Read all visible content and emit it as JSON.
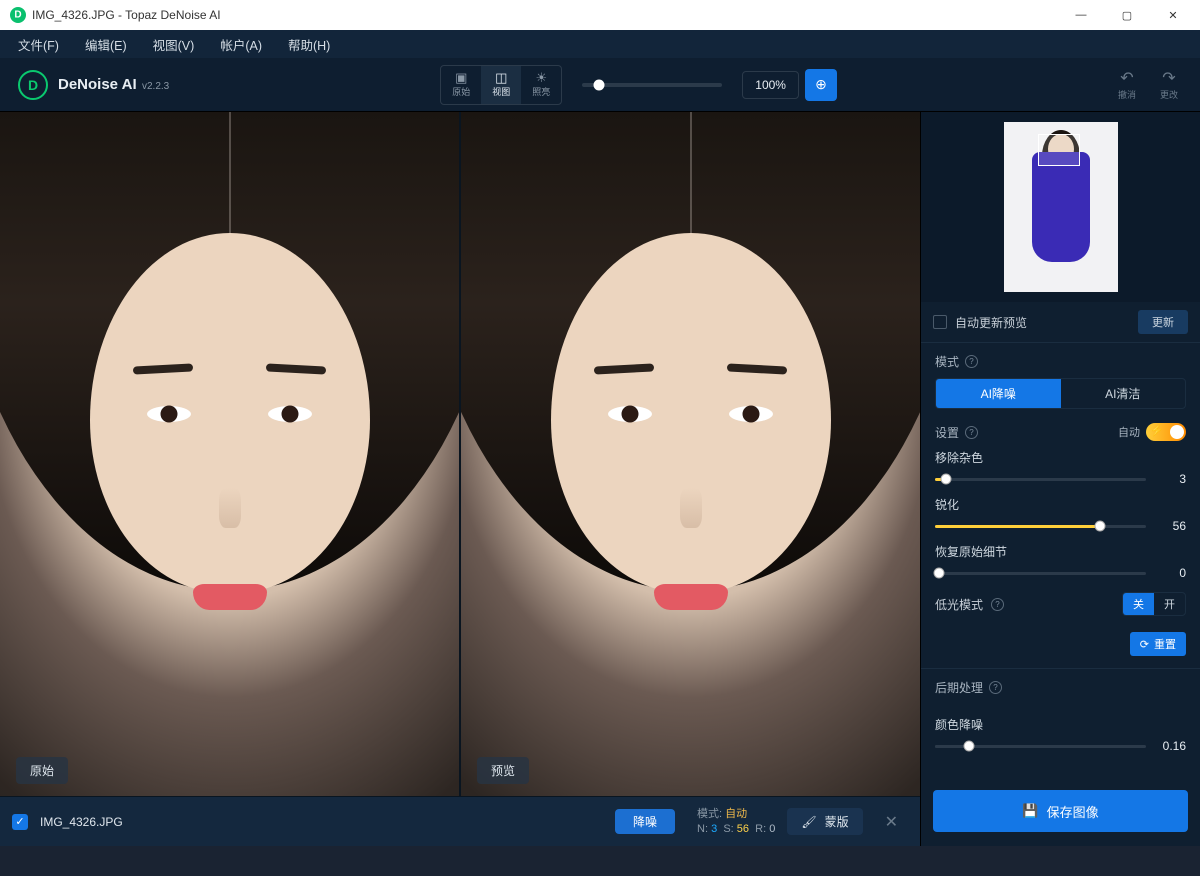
{
  "titlebar": {
    "title": "IMG_4326.JPG - Topaz DeNoise AI"
  },
  "menubar": {
    "file": "文件(F)",
    "edit": "编辑(E)",
    "view": "视图(V)",
    "account": "帐户(A)",
    "help": "帮助(H)"
  },
  "brand": {
    "name": "DeNoise AI",
    "version": "v2.2.3"
  },
  "toolbar": {
    "viewModes": {
      "single": "原始",
      "split": "视图",
      "light": "照亮"
    },
    "zoom": "100%",
    "undo": "撤消",
    "redo": "更改"
  },
  "viewer": {
    "originalLabel": "原始",
    "previewLabel": "预览"
  },
  "bottom": {
    "filename": "IMG_4326.JPG",
    "denoise": "降噪",
    "modeLabel": "模式:",
    "auto": "自动",
    "n_label": "N:",
    "n": "3",
    "s_label": "S:",
    "s": "56",
    "r_label": "R:",
    "r": "0",
    "mask": "蒙版"
  },
  "sidebar": {
    "autoPreview": "自动更新预览",
    "update": "更新",
    "modeLabel": "模式",
    "modeTabs": {
      "denoise": "AI降噪",
      "clear": "AI清洁"
    },
    "settingsLabel": "设置",
    "autoLabel": "自动",
    "removeNoise": {
      "label": "移除杂色",
      "value": "3",
      "percent": 5
    },
    "sharpen": {
      "label": "锐化",
      "value": "56",
      "percent": 78
    },
    "recoverDetail": {
      "label": "恢复原始细节",
      "value": "0",
      "percent": 0
    },
    "lowLight": {
      "label": "低光模式",
      "off": "关",
      "on": "开"
    },
    "reset": "重置",
    "postLabel": "后期处理",
    "colorDenoise": {
      "label": "颜色降噪",
      "value": "0.16",
      "percent": 16
    },
    "save": "保存图像"
  }
}
